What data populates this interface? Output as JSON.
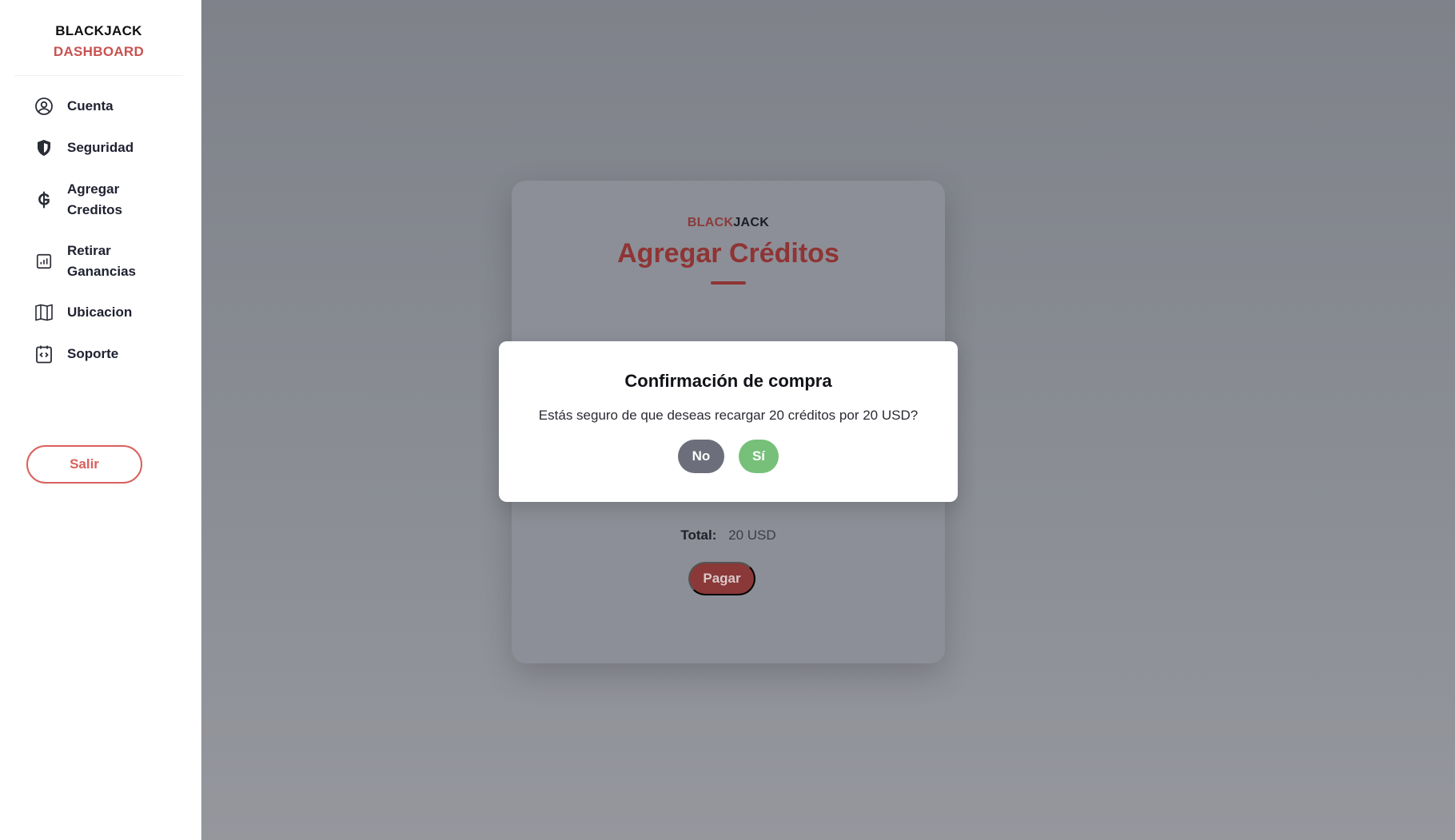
{
  "sidebar": {
    "brand_line1": "BLACKJACK",
    "brand_line2": "DASHBOARD",
    "items": [
      {
        "label": "Cuenta",
        "icon": "user-circle-icon"
      },
      {
        "label": "Seguridad",
        "icon": "shield-icon"
      },
      {
        "label": "Agregar Creditos",
        "icon": "currency-icon"
      },
      {
        "label": "Retirar Ganancias",
        "icon": "chart-icon"
      },
      {
        "label": "Ubicacion",
        "icon": "map-icon"
      },
      {
        "label": "Soporte",
        "icon": "code-clipboard-icon"
      }
    ],
    "logout_label": "Salir"
  },
  "card": {
    "brand_red": "BLACK",
    "brand_dark": "JACK",
    "title": "Agregar Créditos",
    "total_label": "Total:",
    "total_value": "20 USD",
    "pay_label": "Pagar"
  },
  "modal": {
    "title": "Confirmación de compra",
    "message": "Estás seguro de que deseas recargar 20 créditos por 20 USD?",
    "no_label": "No",
    "yes_label": "Sí"
  },
  "colors": {
    "accent_red": "#c8524f",
    "confirm_green": "#76c07a",
    "cancel_gray": "#6c6f7b"
  }
}
